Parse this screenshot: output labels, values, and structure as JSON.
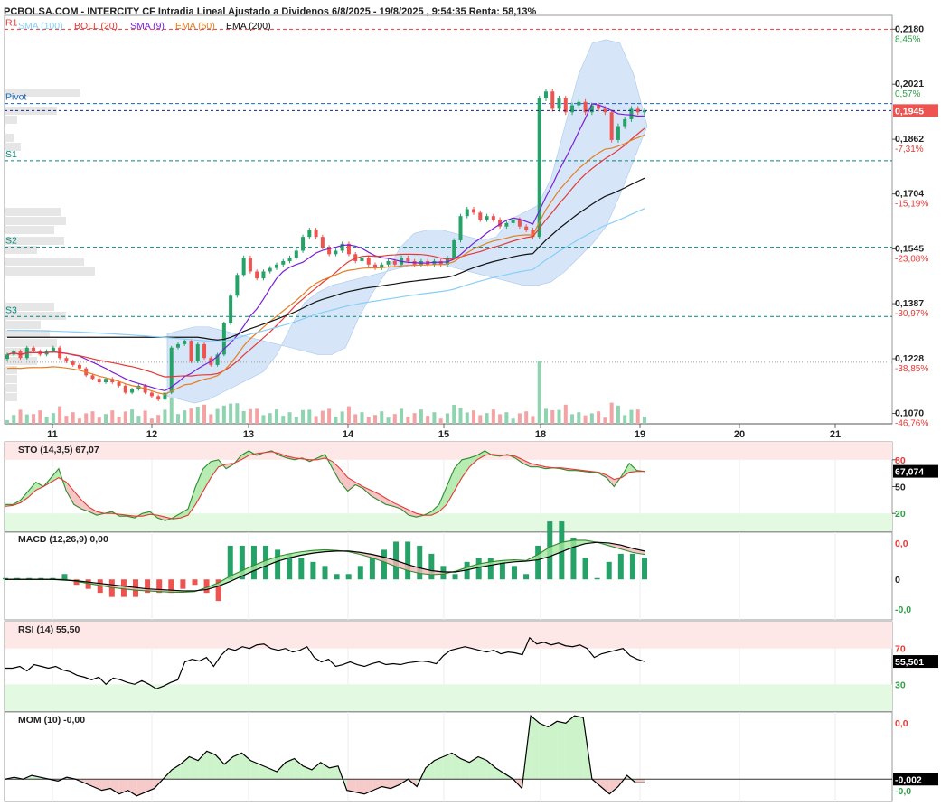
{
  "header": {
    "title": "PCBOLSA.COM - INTERCITY CF Intradia Lineal Ajustado a Dividenos 6/8/2025 - 19/8/2025 , 9:54:35 Renta: 58,13%",
    "legend": [
      {
        "label": "SMA (100)",
        "color": "#87cefa"
      },
      {
        "label": "BOLL (20)",
        "color": "#e53935"
      },
      {
        "label": "SMA (9)",
        "color": "#7b1fd6"
      },
      {
        "label": "EMA (50)",
        "color": "#e67e22"
      },
      {
        "label": "EMA (200)",
        "color": "#111111"
      }
    ]
  },
  "colors": {
    "up": "#26a269",
    "down": "#ef5350",
    "band": "#cfe2f7",
    "last": "#ef5350"
  },
  "chart_data": [
    {
      "type": "candlestick",
      "name": "price",
      "x_ticks": [
        "11",
        "12",
        "13",
        "14",
        "15",
        "18",
        "19",
        "20",
        "21"
      ],
      "y_ticks": [
        "0,2180",
        "0,2021",
        "0,1862",
        "0,1704",
        "0,1545",
        "0,1387",
        "0,1228",
        "0,1070"
      ],
      "y_pct": [
        "8,45%",
        "0,57%",
        "-7,31%",
        "-15,19%",
        "-23,08%",
        "-30,97%",
        "-38,85%",
        "-46,76%"
      ],
      "ylim": [
        0.104,
        0.222
      ],
      "last_price": "0,1945",
      "pivot_levels": [
        {
          "name": "R1",
          "value": 0.218,
          "color": "#e53935"
        },
        {
          "name": "Pivot",
          "value": 0.1965,
          "color": "#1565c0"
        },
        {
          "name": "S1",
          "value": 0.18,
          "color": "#00897b"
        },
        {
          "name": "S2",
          "value": 0.155,
          "color": "#00897b"
        },
        {
          "name": "S3",
          "value": 0.135,
          "color": "#00897b"
        }
      ],
      "close": [
        0.124,
        0.125,
        0.123,
        0.126,
        0.125,
        0.124,
        0.125,
        0.126,
        0.123,
        0.122,
        0.121,
        0.12,
        0.118,
        0.117,
        0.116,
        0.117,
        0.116,
        0.115,
        0.113,
        0.114,
        0.115,
        0.113,
        0.112,
        0.111,
        0.113,
        0.126,
        0.127,
        0.128,
        0.122,
        0.127,
        0.123,
        0.121,
        0.124,
        0.133,
        0.141,
        0.147,
        0.152,
        0.148,
        0.146,
        0.148,
        0.149,
        0.15,
        0.151,
        0.152,
        0.154,
        0.158,
        0.16,
        0.158,
        0.155,
        0.153,
        0.154,
        0.156,
        0.153,
        0.151,
        0.152,
        0.15,
        0.149,
        0.15,
        0.151,
        0.15,
        0.152,
        0.151,
        0.15,
        0.151,
        0.15,
        0.151,
        0.15,
        0.152,
        0.157,
        0.164,
        0.166,
        0.165,
        0.163,
        0.164,
        0.163,
        0.161,
        0.162,
        0.163,
        0.161,
        0.16,
        0.158,
        0.198,
        0.2,
        0.195,
        0.198,
        0.194,
        0.196,
        0.197,
        0.194,
        0.196,
        0.195,
        0.194,
        0.186,
        0.19,
        0.192,
        0.195,
        0.194,
        0.1945
      ],
      "bollinger_upper": [
        0.13,
        0.131,
        0.132,
        0.132,
        0.131,
        0.13,
        0.129,
        0.128,
        0.127,
        0.126,
        0.125,
        0.124,
        0.124,
        0.126,
        0.135,
        0.142,
        0.148,
        0.155,
        0.159,
        0.16,
        0.16,
        0.159,
        0.158,
        0.157,
        0.158,
        0.163,
        0.165,
        0.167,
        0.175,
        0.19,
        0.205,
        0.214,
        0.215,
        0.214,
        0.205,
        0.19
      ],
      "bollinger_lower": [
        0.112,
        0.111,
        0.11,
        0.111,
        0.113,
        0.115,
        0.117,
        0.119,
        0.124,
        0.132,
        0.139,
        0.142,
        0.144,
        0.145,
        0.146,
        0.147,
        0.148,
        0.149,
        0.15,
        0.151,
        0.15,
        0.149,
        0.148,
        0.147,
        0.146,
        0.145,
        0.144,
        0.144,
        0.145,
        0.148,
        0.152,
        0.156,
        0.161,
        0.17,
        0.18,
        0.19
      ]
    },
    {
      "type": "line",
      "name": "STO (14,3,5)",
      "header_value": "67,07",
      "last_label": "67,074",
      "ylim": [
        0,
        100
      ],
      "y_ticks": [
        "80",
        "50",
        "20"
      ],
      "k": [
        30,
        30,
        35,
        45,
        55,
        50,
        60,
        70,
        45,
        30,
        25,
        22,
        18,
        20,
        22,
        17,
        17,
        15,
        20,
        22,
        15,
        12,
        15,
        20,
        25,
        50,
        70,
        78,
        80,
        70,
        75,
        85,
        90,
        85,
        88,
        90,
        85,
        82,
        80,
        82,
        78,
        82,
        86,
        70,
        55,
        45,
        52,
        48,
        40,
        35,
        30,
        28,
        25,
        18,
        16,
        18,
        22,
        30,
        50,
        70,
        80,
        82,
        85,
        90,
        85,
        84,
        86,
        82,
        76,
        72,
        72,
        70,
        71,
        70,
        68,
        68,
        67,
        66,
        65,
        60,
        50,
        62,
        76,
        68,
        67
      ],
      "d": [
        28,
        29,
        32,
        38,
        46,
        50,
        55,
        60,
        55,
        45,
        35,
        27,
        22,
        20,
        20,
        19,
        18,
        17,
        17,
        19,
        18,
        16,
        14,
        15,
        18,
        30,
        45,
        60,
        72,
        75,
        76,
        80,
        85,
        87,
        88,
        89,
        87,
        84,
        82,
        81,
        80,
        80,
        82,
        78,
        70,
        60,
        55,
        50,
        46,
        42,
        37,
        32,
        28,
        24,
        20,
        18,
        18,
        22,
        30,
        45,
        60,
        72,
        80,
        85,
        86,
        85,
        85,
        84,
        80,
        76,
        74,
        72,
        71,
        71,
        70,
        69,
        68,
        67,
        66,
        63,
        58,
        60,
        66,
        67,
        67
      ]
    },
    {
      "type": "line",
      "name": "MACD (12,26,9)",
      "header_value": "0,00",
      "ylim": [
        -0.006,
        0.007
      ],
      "y_ticks": [
        "0,0",
        "0",
        "-0,0"
      ],
      "macd": [
        0,
        0,
        0,
        0,
        0,
        0,
        -0.0003,
        -0.0006,
        -0.0009,
        -0.0012,
        -0.0014,
        -0.0016,
        -0.0017,
        -0.0018,
        -0.0019,
        -0.0019,
        -0.0018,
        -0.0012,
        -0.0005,
        0.0005,
        0.0013,
        0.0021,
        0.0028,
        0.0034,
        0.0038,
        0.0041,
        0.0043,
        0.0044,
        0.0043,
        0.0041,
        0.0037,
        0.0032,
        0.0026,
        0.0019,
        0.0013,
        0.0009,
        0.0007,
        0.0008,
        0.0012,
        0.0018,
        0.0023,
        0.0026,
        0.0028,
        0.0029,
        0.0028,
        0.0037,
        0.0048,
        0.0055,
        0.0058,
        0.0058,
        0.0055,
        0.005,
        0.0045,
        0.004,
        0.0037
      ],
      "signal": [
        0,
        0,
        0,
        0,
        0,
        -0.0001,
        -0.0002,
        -0.0004,
        -0.0006,
        -0.0008,
        -0.001,
        -0.0012,
        -0.0014,
        -0.0015,
        -0.0016,
        -0.0017,
        -0.0017,
        -0.0015,
        -0.001,
        -0.0003,
        0.0005,
        0.0013,
        0.002,
        0.0027,
        0.0032,
        0.0036,
        0.0039,
        0.0041,
        0.0042,
        0.0042,
        0.004,
        0.0037,
        0.0033,
        0.0028,
        0.0022,
        0.0017,
        0.0013,
        0.0011,
        0.0011,
        0.0014,
        0.0018,
        0.0021,
        0.0024,
        0.0026,
        0.0027,
        0.0029,
        0.0034,
        0.0041,
        0.0048,
        0.0053,
        0.0055,
        0.0054,
        0.0051,
        0.0046,
        0.0042
      ]
    },
    {
      "type": "line",
      "name": "RSI (14)",
      "header_value": "55,50",
      "last_label": "55,501",
      "ylim": [
        0,
        100
      ],
      "y_ticks": [
        "70",
        "30"
      ],
      "values": [
        48,
        48,
        50,
        45,
        52,
        50,
        48,
        50,
        46,
        44,
        40,
        38,
        35,
        38,
        30,
        37,
        35,
        32,
        30,
        34,
        30,
        25,
        28,
        32,
        35,
        55,
        58,
        56,
        60,
        50,
        62,
        70,
        68,
        72,
        70,
        74,
        75,
        70,
        68,
        70,
        66,
        68,
        72,
        60,
        55,
        58,
        50,
        52,
        55,
        52,
        50,
        53,
        55,
        52,
        53,
        52,
        54,
        55,
        56,
        55,
        53,
        62,
        68,
        70,
        72,
        70,
        68,
        66,
        68,
        64,
        66,
        65,
        63,
        82,
        75,
        77,
        74,
        76,
        73,
        72,
        74,
        70,
        60,
        64,
        66,
        68,
        70,
        62,
        58,
        55.5
      ]
    },
    {
      "type": "line",
      "name": "MOM (10)",
      "header_value": "-0,00",
      "last_label": "-0,002",
      "ylim": [
        -0.012,
        0.036
      ],
      "y_ticks": [
        "0,0",
        "-0,0"
      ],
      "values": [
        0,
        0.001,
        0,
        0.002,
        0.001,
        0,
        -0.001,
        0.001,
        0,
        -0.002,
        -0.004,
        -0.006,
        -0.005,
        -0.008,
        -0.006,
        -0.009,
        -0.007,
        -0.005,
        0,
        0.005,
        0.008,
        0.012,
        0.01,
        0.015,
        0.013,
        0.008,
        0.012,
        0.014,
        0.01,
        0.008,
        0.006,
        0.004,
        0.009,
        0.011,
        0.007,
        0.005,
        0.009,
        0.006,
        0.007,
        -0.006,
        -0.007,
        -0.008,
        -0.006,
        -0.004,
        -0.005,
        -0.003,
        0,
        -0.004,
        0.006,
        0.01,
        0.012,
        0.014,
        0.011,
        0.009,
        0.012,
        0.01,
        0.006,
        0.003,
        0,
        -0.005,
        0.034,
        0.03,
        0.028,
        0.031,
        0.03,
        0.034,
        0.033,
        0,
        -0.004,
        -0.008,
        -0.004,
        0.002,
        -0.002,
        -0.002
      ]
    }
  ]
}
